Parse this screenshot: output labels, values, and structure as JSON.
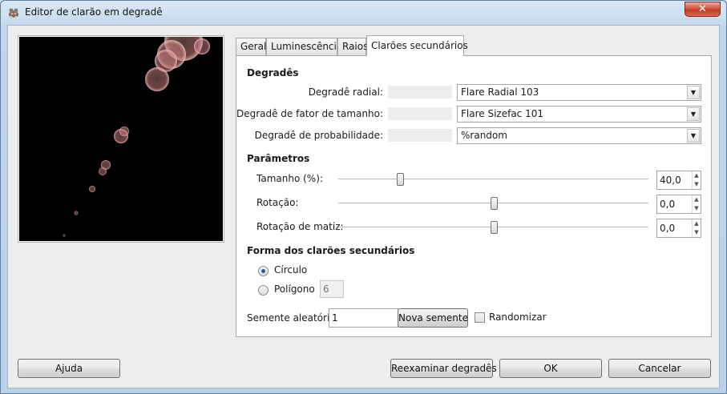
{
  "window": {
    "title": "Editor de clarão em degradê",
    "close_glyph": "✕"
  },
  "tabs": [
    {
      "label": "Geral"
    },
    {
      "label": "Luminescência"
    },
    {
      "label": "Raios"
    },
    {
      "label": "Clarões secundários",
      "active": true
    }
  ],
  "gradients": {
    "section_title": "Degradês",
    "rows": [
      {
        "label": "Degradê radial:",
        "value": "Flare Radial 103"
      },
      {
        "label": "Degradê de fator de tamanho:",
        "value": "Flare Sizefac 101"
      },
      {
        "label": "Degradê de probabilidade:",
        "value": "%random"
      }
    ]
  },
  "parameters": {
    "section_title": "Parâmetros",
    "rows": [
      {
        "label": "Tamanho (%):",
        "value": "40,0",
        "level": 0.2
      },
      {
        "label": "Rotação:",
        "value": "0,0",
        "level": 0.5
      },
      {
        "label": "Rotação de matiz:",
        "value": "0,0",
        "level": 0.5
      }
    ]
  },
  "shape": {
    "section_title": "Forma dos clarões secundários",
    "options": [
      {
        "label": "Círculo",
        "checked": true
      },
      {
        "label": "Polígono",
        "checked": false
      }
    ],
    "polygon_sides": "6"
  },
  "seed": {
    "label": "Semente aleatória:",
    "value": "1",
    "new_seed_button": "Nova semente",
    "randomize_label": "Randomizar"
  },
  "footer": {
    "help_button": "Ajuda",
    "rescan_button": "Reexaminar degradês",
    "ok_button": "OK",
    "cancel_button": "Cancelar"
  },
  "colors": {
    "accent_radio": "#2a5b9c",
    "preview_bg": "#000000"
  }
}
